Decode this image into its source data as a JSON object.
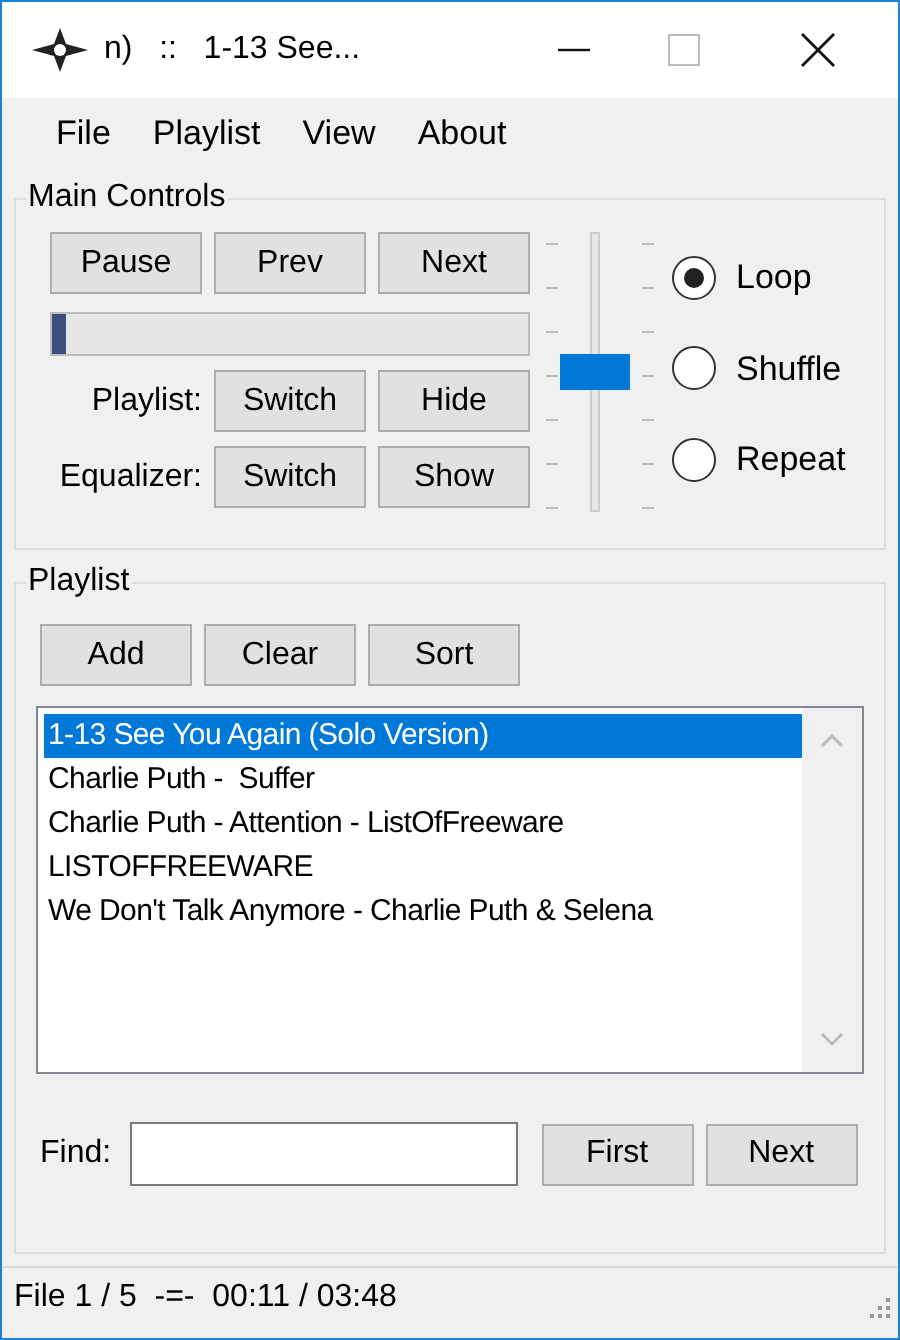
{
  "window": {
    "title": "n)   ::   1-13 See..."
  },
  "menu": [
    "File",
    "Playlist",
    "View",
    "About"
  ],
  "main_controls": {
    "title": "Main Controls",
    "transport_buttons": [
      "Pause",
      "Prev",
      "Next"
    ],
    "progress": {
      "level": 0.03
    },
    "rows": [
      {
        "label": "Playlist:",
        "buttons": [
          "Switch",
          "Hide"
        ]
      },
      {
        "label": "Equalizer:",
        "buttons": [
          "Switch",
          "Show"
        ]
      }
    ],
    "volume": {
      "level": 0.5
    },
    "modes": [
      {
        "label": "Loop",
        "selected": true
      },
      {
        "label": "Shuffle",
        "selected": false
      },
      {
        "label": "Repeat",
        "selected": false
      }
    ]
  },
  "playlist": {
    "title": "Playlist",
    "buttons": [
      "Add",
      "Clear",
      "Sort"
    ],
    "items": [
      {
        "label": "1-13 See You Again (Solo Version)",
        "selected": true
      },
      {
        "label": "Charlie Puth -  Suffer",
        "selected": false
      },
      {
        "label": "Charlie Puth - Attention - ListOfFreeware",
        "selected": false
      },
      {
        "label": "LISTOFFREEWARE",
        "selected": false
      },
      {
        "label": "We Don't Talk Anymore - Charlie Puth & Selena",
        "selected": false
      }
    ],
    "find": {
      "label": "Find:",
      "buttons": [
        "First",
        "Next"
      ]
    }
  },
  "status_bar": "File 1 / 5  -=-  00:11 / 03:48"
}
